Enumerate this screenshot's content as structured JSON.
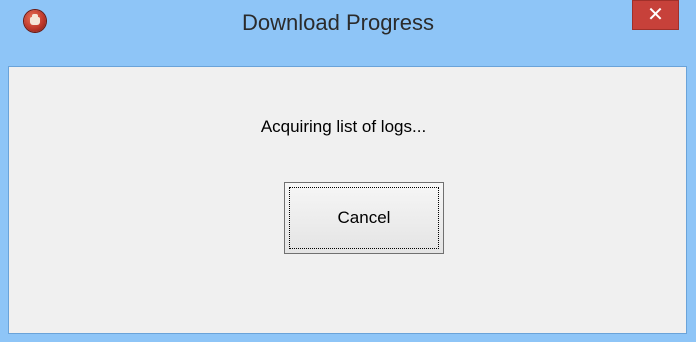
{
  "window": {
    "title": "Download Progress",
    "app_icon": "app-icon",
    "close_glyph": "✕",
    "titlebar_color": "#8ec5f7",
    "close_color": "#c7413a"
  },
  "dialog": {
    "message": "Acquiring list of logs...",
    "cancel_label": "Cancel"
  }
}
